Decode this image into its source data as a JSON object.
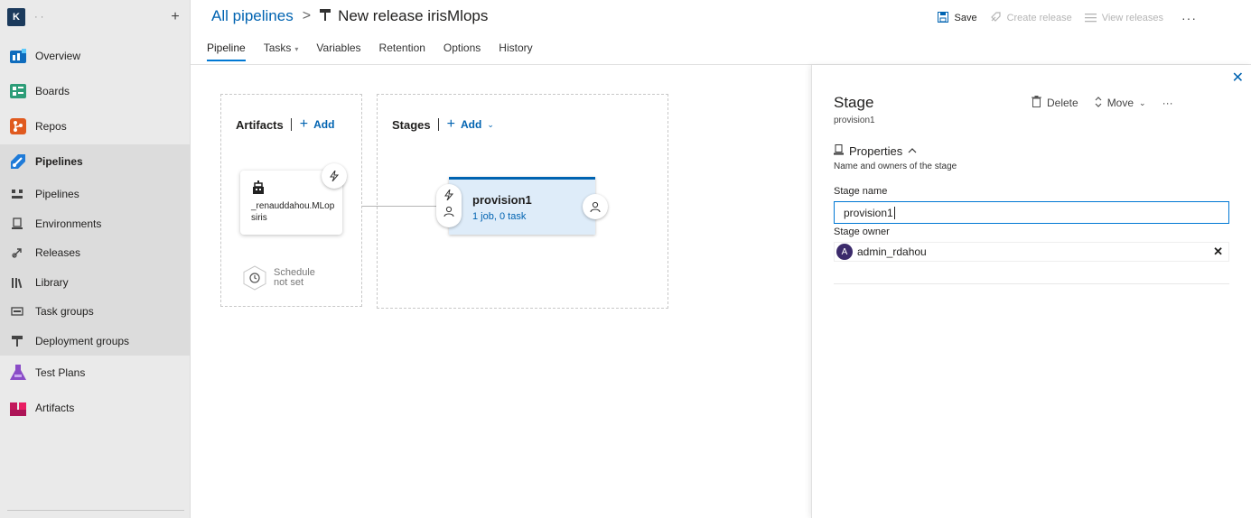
{
  "org": {
    "initial": "K",
    "name": "·  ·"
  },
  "sidebar": {
    "items": [
      {
        "label": "Overview",
        "icon": "overview-icon"
      },
      {
        "label": "Boards",
        "icon": "boards-icon"
      },
      {
        "label": "Repos",
        "icon": "repos-icon"
      },
      {
        "label": "Pipelines",
        "icon": "pipelines-icon"
      },
      {
        "label": "Pipelines",
        "icon": "pipelines-sub-icon"
      },
      {
        "label": "Environments",
        "icon": "environments-icon"
      },
      {
        "label": "Releases",
        "icon": "releases-icon"
      },
      {
        "label": "Library",
        "icon": "library-icon"
      },
      {
        "label": "Task groups",
        "icon": "task-groups-icon"
      },
      {
        "label": "Deployment groups",
        "icon": "deployment-groups-icon"
      },
      {
        "label": "Test Plans",
        "icon": "test-plans-icon"
      },
      {
        "label": "Artifacts",
        "icon": "artifacts-icon"
      }
    ]
  },
  "header": {
    "breadcrumb_root": "All pipelines",
    "title": "New release irisMlops",
    "save": "Save",
    "create_release": "Create release",
    "view_releases": "View releases"
  },
  "tabs": [
    {
      "label": "Pipeline"
    },
    {
      "label": "Tasks"
    },
    {
      "label": "Variables"
    },
    {
      "label": "Retention"
    },
    {
      "label": "Options"
    },
    {
      "label": "History"
    }
  ],
  "canvas": {
    "artifacts_title": "Artifacts",
    "artifacts_add": "Add",
    "artifact_name": "_renauddahou.MLopsiris",
    "schedule_line1": "Schedule",
    "schedule_line2": "not set",
    "stages_title": "Stages",
    "stages_add": "Add",
    "stage_name": "provision1",
    "stage_info": "1 job, 0 task"
  },
  "panel": {
    "title": "Stage",
    "subtitle": "provision1",
    "delete": "Delete",
    "move": "Move",
    "properties": "Properties",
    "properties_desc": "Name and owners of the stage",
    "stage_name_label": "Stage name",
    "stage_name_value": "provision1",
    "stage_owner_label": "Stage owner",
    "owner_initial": "A",
    "owner_name": "admin_rdahou"
  },
  "colors": {
    "accent": "#0063b1",
    "stage_fill": "#deecf9"
  }
}
